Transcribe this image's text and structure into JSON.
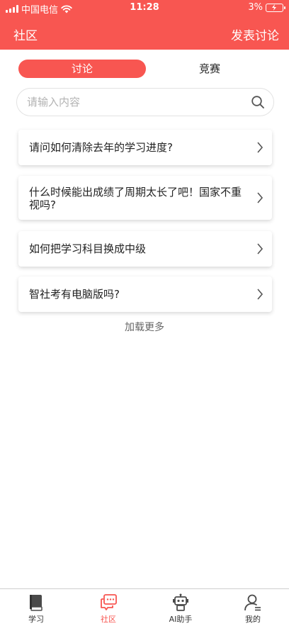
{
  "status_bar": {
    "carrier": "中国电信",
    "time": "11:28",
    "battery": "3%"
  },
  "nav": {
    "title": "社区",
    "action_label": "发表讨论"
  },
  "tabs": [
    {
      "label": "讨论",
      "active": true
    },
    {
      "label": "竞赛",
      "active": false
    }
  ],
  "search": {
    "placeholder": "请输入内容",
    "value": ""
  },
  "posts": [
    {
      "title": "请问如何清除去年的学习进度?"
    },
    {
      "title": "什么时候能出成绩了周期太长了吧！国家不重视吗?"
    },
    {
      "title": "如何把学习科目换成中级"
    },
    {
      "title": "智社考有电脑版吗?"
    }
  ],
  "load_more": "加载更多",
  "tabbar": [
    {
      "label": "学习",
      "icon": "book-icon",
      "active": false
    },
    {
      "label": "社区",
      "icon": "chat-icon",
      "active": true
    },
    {
      "label": "AI助手",
      "icon": "robot-icon",
      "active": false
    },
    {
      "label": "我的",
      "icon": "user-icon",
      "active": false
    }
  ],
  "colors": {
    "accent": "#f85651",
    "text": "#222222",
    "placeholder": "#b3b3b3"
  }
}
